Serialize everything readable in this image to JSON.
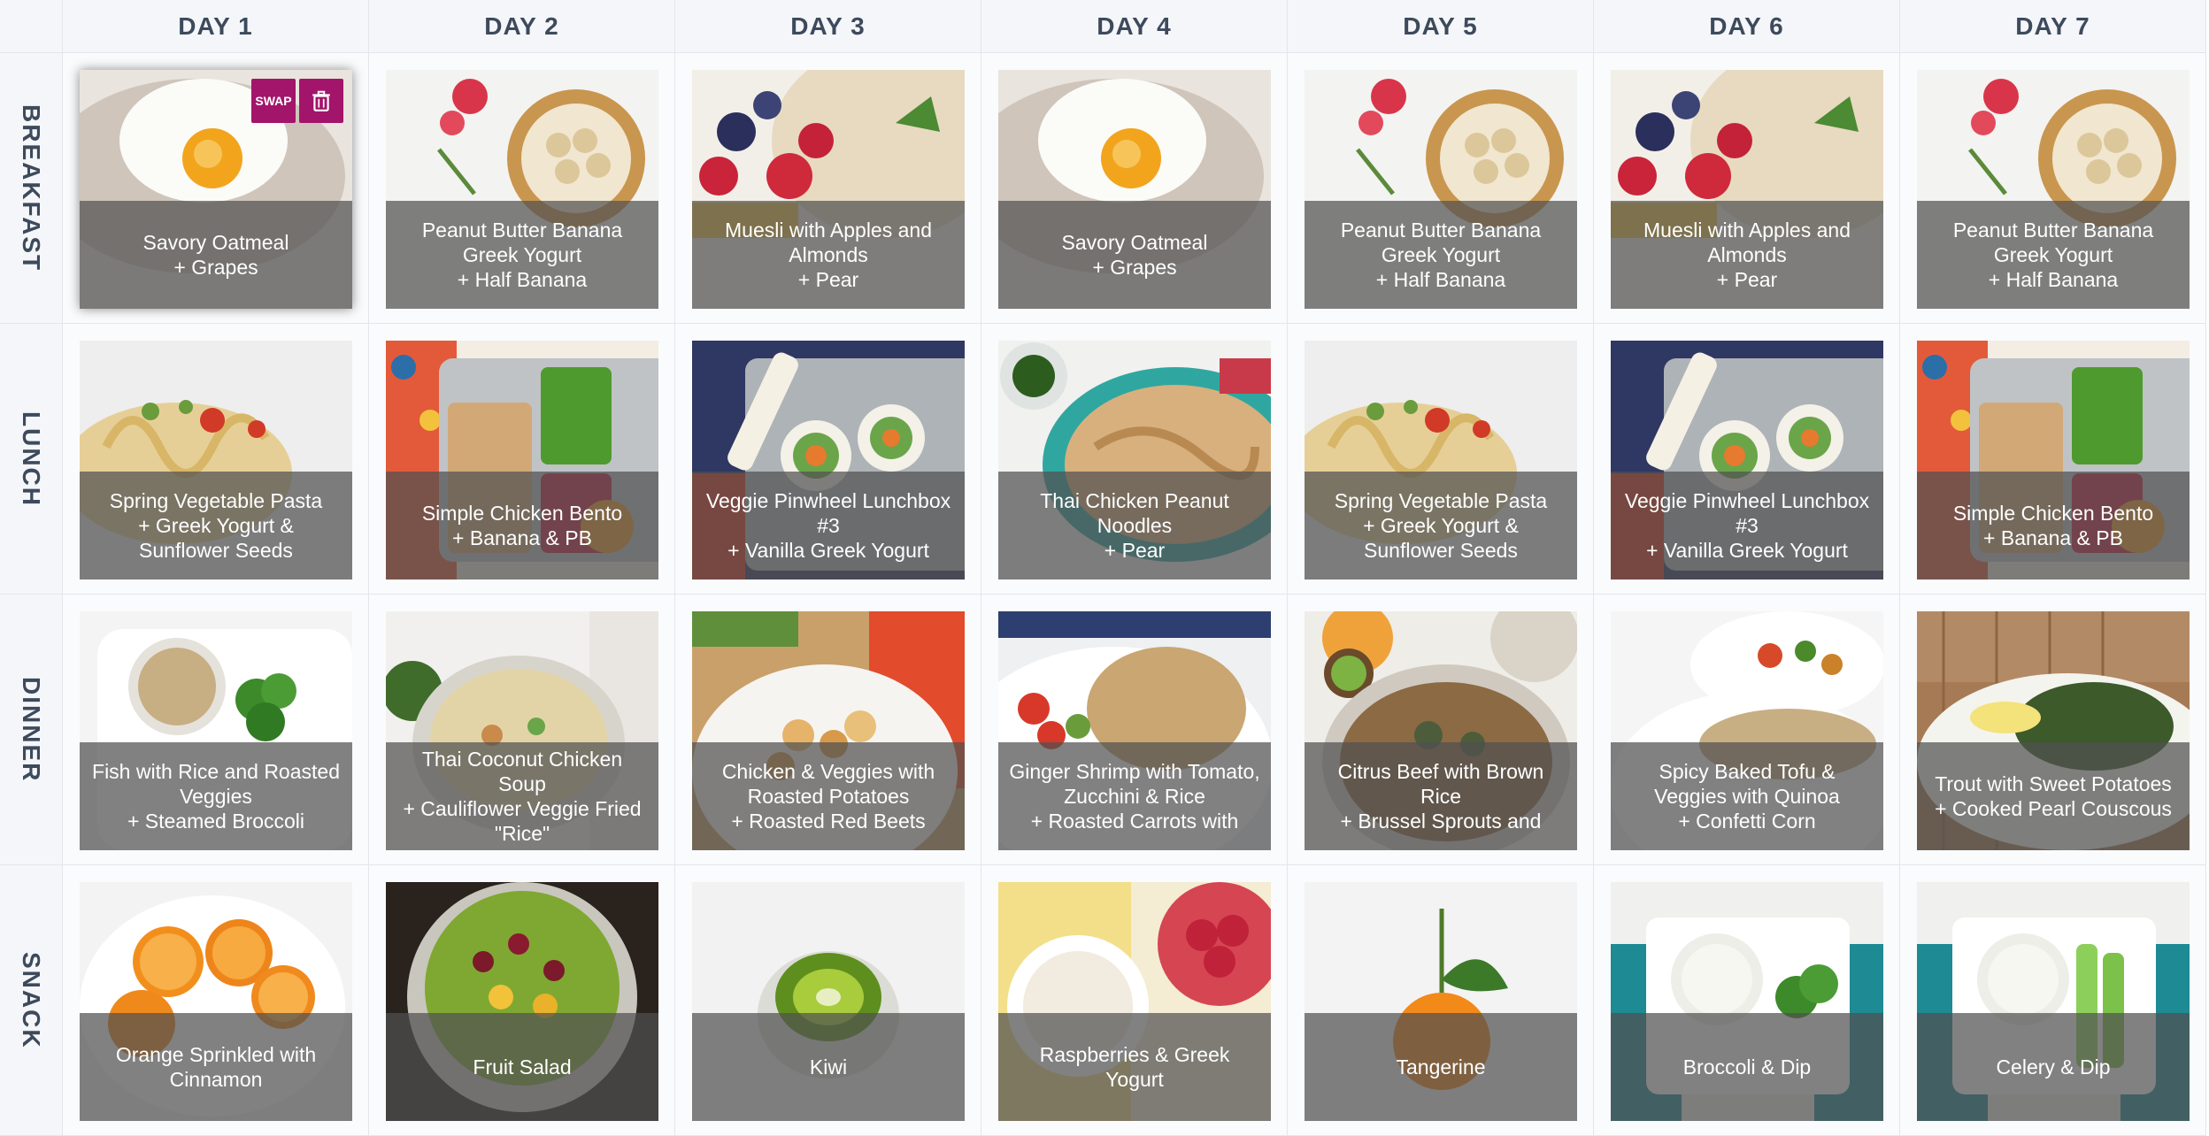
{
  "days": [
    "DAY 1",
    "DAY 2",
    "DAY 3",
    "DAY 4",
    "DAY 5",
    "DAY 6",
    "DAY 7"
  ],
  "meals": [
    "BREAKFAST",
    "LUNCH",
    "DINNER",
    "SNACK"
  ],
  "card_actions": {
    "swap_label": "SWAP",
    "delete_icon": "trash-icon",
    "accent": "#a3146b"
  },
  "grid": [
    [
      {
        "title": "Savory Oatmeal",
        "side": "+ Grapes",
        "photo": "egg"
      },
      {
        "title": "Peanut Butter Banana Greek Yogurt",
        "side": "+ Half Banana",
        "photo": "yogurt"
      },
      {
        "title": "Muesli with Apples and Almonds",
        "side": "+ Pear",
        "photo": "muesli"
      },
      {
        "title": "Savory Oatmeal",
        "side": "+ Grapes",
        "photo": "egg"
      },
      {
        "title": "Peanut Butter Banana Greek Yogurt",
        "side": "+ Half Banana",
        "photo": "yogurt"
      },
      {
        "title": "Muesli with Apples and Almonds",
        "side": "+ Pear",
        "photo": "muesli"
      },
      {
        "title": "Peanut Butter Banana Greek Yogurt",
        "side": "+ Half Banana",
        "photo": "yogurt"
      }
    ],
    [
      {
        "title": "Spring Vegetable Pasta",
        "side": "+ Greek Yogurt & Sunflower Seeds",
        "photo": "pasta"
      },
      {
        "title": "Simple Chicken Bento",
        "side": "+ Banana & PB",
        "photo": "bento"
      },
      {
        "title": "Veggie Pinwheel Lunchbox #3",
        "side": "+ Vanilla Greek Yogurt",
        "photo": "pinwheel"
      },
      {
        "title": "Thai Chicken Peanut Noodles",
        "side": "+ Pear",
        "photo": "noodles"
      },
      {
        "title": "Spring Vegetable Pasta",
        "side": "+ Greek Yogurt & Sunflower Seeds",
        "photo": "pasta"
      },
      {
        "title": "Veggie Pinwheel Lunchbox #3",
        "side": "+ Vanilla Greek Yogurt",
        "photo": "pinwheel"
      },
      {
        "title": "Simple Chicken Bento",
        "side": "+ Banana & PB",
        "photo": "bento"
      }
    ],
    [
      {
        "title": "Fish with Rice and Roasted Veggies",
        "side": "+ Steamed Broccoli",
        "photo": "fish"
      },
      {
        "title": "Thai Coconut Chicken Soup",
        "side": "+ Cauliflower Veggie Fried \"Rice\"",
        "photo": "soup"
      },
      {
        "title": "Chicken & Veggies with Roasted Potatoes",
        "side": "+ Roasted Red Beets",
        "photo": "chickenveg"
      },
      {
        "title": "Ginger Shrimp with Tomato, Zucchini & Rice",
        "side": "+ Roasted Carrots with",
        "photo": "shrimp"
      },
      {
        "title": "Citrus Beef with Brown Rice",
        "side": "+ Brussel Sprouts and",
        "photo": "beef"
      },
      {
        "title": "Spicy Baked Tofu & Veggies with Quinoa",
        "side": "+ Confetti Corn",
        "photo": "tofu"
      },
      {
        "title": "Trout with Sweet Potatoes",
        "side": "+ Cooked Pearl Couscous",
        "photo": "trout"
      }
    ],
    [
      {
        "title": "Orange Sprinkled with Cinnamon",
        "side": "",
        "photo": "orange"
      },
      {
        "title": "Fruit Salad",
        "side": "",
        "photo": "fruitsalad"
      },
      {
        "title": "Kiwi",
        "side": "",
        "photo": "kiwi"
      },
      {
        "title": "Raspberries & Greek Yogurt",
        "side": "",
        "photo": "raspberries"
      },
      {
        "title": "Tangerine",
        "side": "",
        "photo": "tangerine"
      },
      {
        "title": "Broccoli & Dip",
        "side": "",
        "photo": "broccolidip"
      },
      {
        "title": "Celery & Dip",
        "side": "",
        "photo": "celerydip"
      }
    ]
  ]
}
